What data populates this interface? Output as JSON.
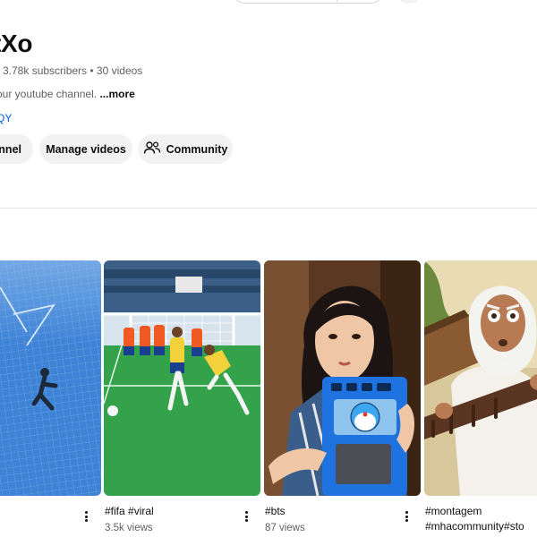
{
  "channel": {
    "name": "tXo",
    "subscribers": "3.78k subscribers",
    "separator": " • ",
    "videos": "30 videos",
    "description": "our youtube channel.",
    "more_label": "...more",
    "link_text": "QY"
  },
  "actions": {
    "channel_label": "annel",
    "manage_label": "Manage videos",
    "community_label": "Community"
  },
  "shorts": [
    {
      "title": "",
      "title2": "",
      "views": ""
    },
    {
      "title": "#fifa #viral",
      "title2": "",
      "views": "3.5k views"
    },
    {
      "title": "#bts",
      "title2": "",
      "views": "87 views"
    },
    {
      "title": "#montagem",
      "title2": "#mhacommunity#sto",
      "views": ""
    }
  ],
  "colors": {
    "accent_link": "#065fd4",
    "pill_bg": "#f2f2f2",
    "secondary_text": "#606060"
  }
}
